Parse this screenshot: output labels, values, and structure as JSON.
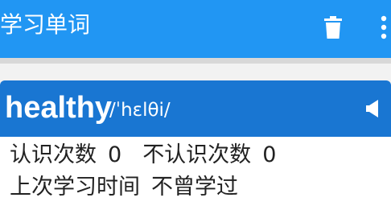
{
  "appbar": {
    "title": "学习单词",
    "delete_icon": "trash-icon",
    "more_icon": "more-vert-icon",
    "color": "#2196f3"
  },
  "word": {
    "text": "healthy",
    "phonetic": "/ˈhɛlθi/",
    "speaker_icon": "speaker-icon",
    "header_color": "#1976d2"
  },
  "stats": {
    "known_label": "认识次数",
    "known_count": "0",
    "unknown_label": "不认识次数",
    "unknown_count": "0",
    "last_study_label": "上次学习时间",
    "last_study_value": "不曾学过"
  }
}
